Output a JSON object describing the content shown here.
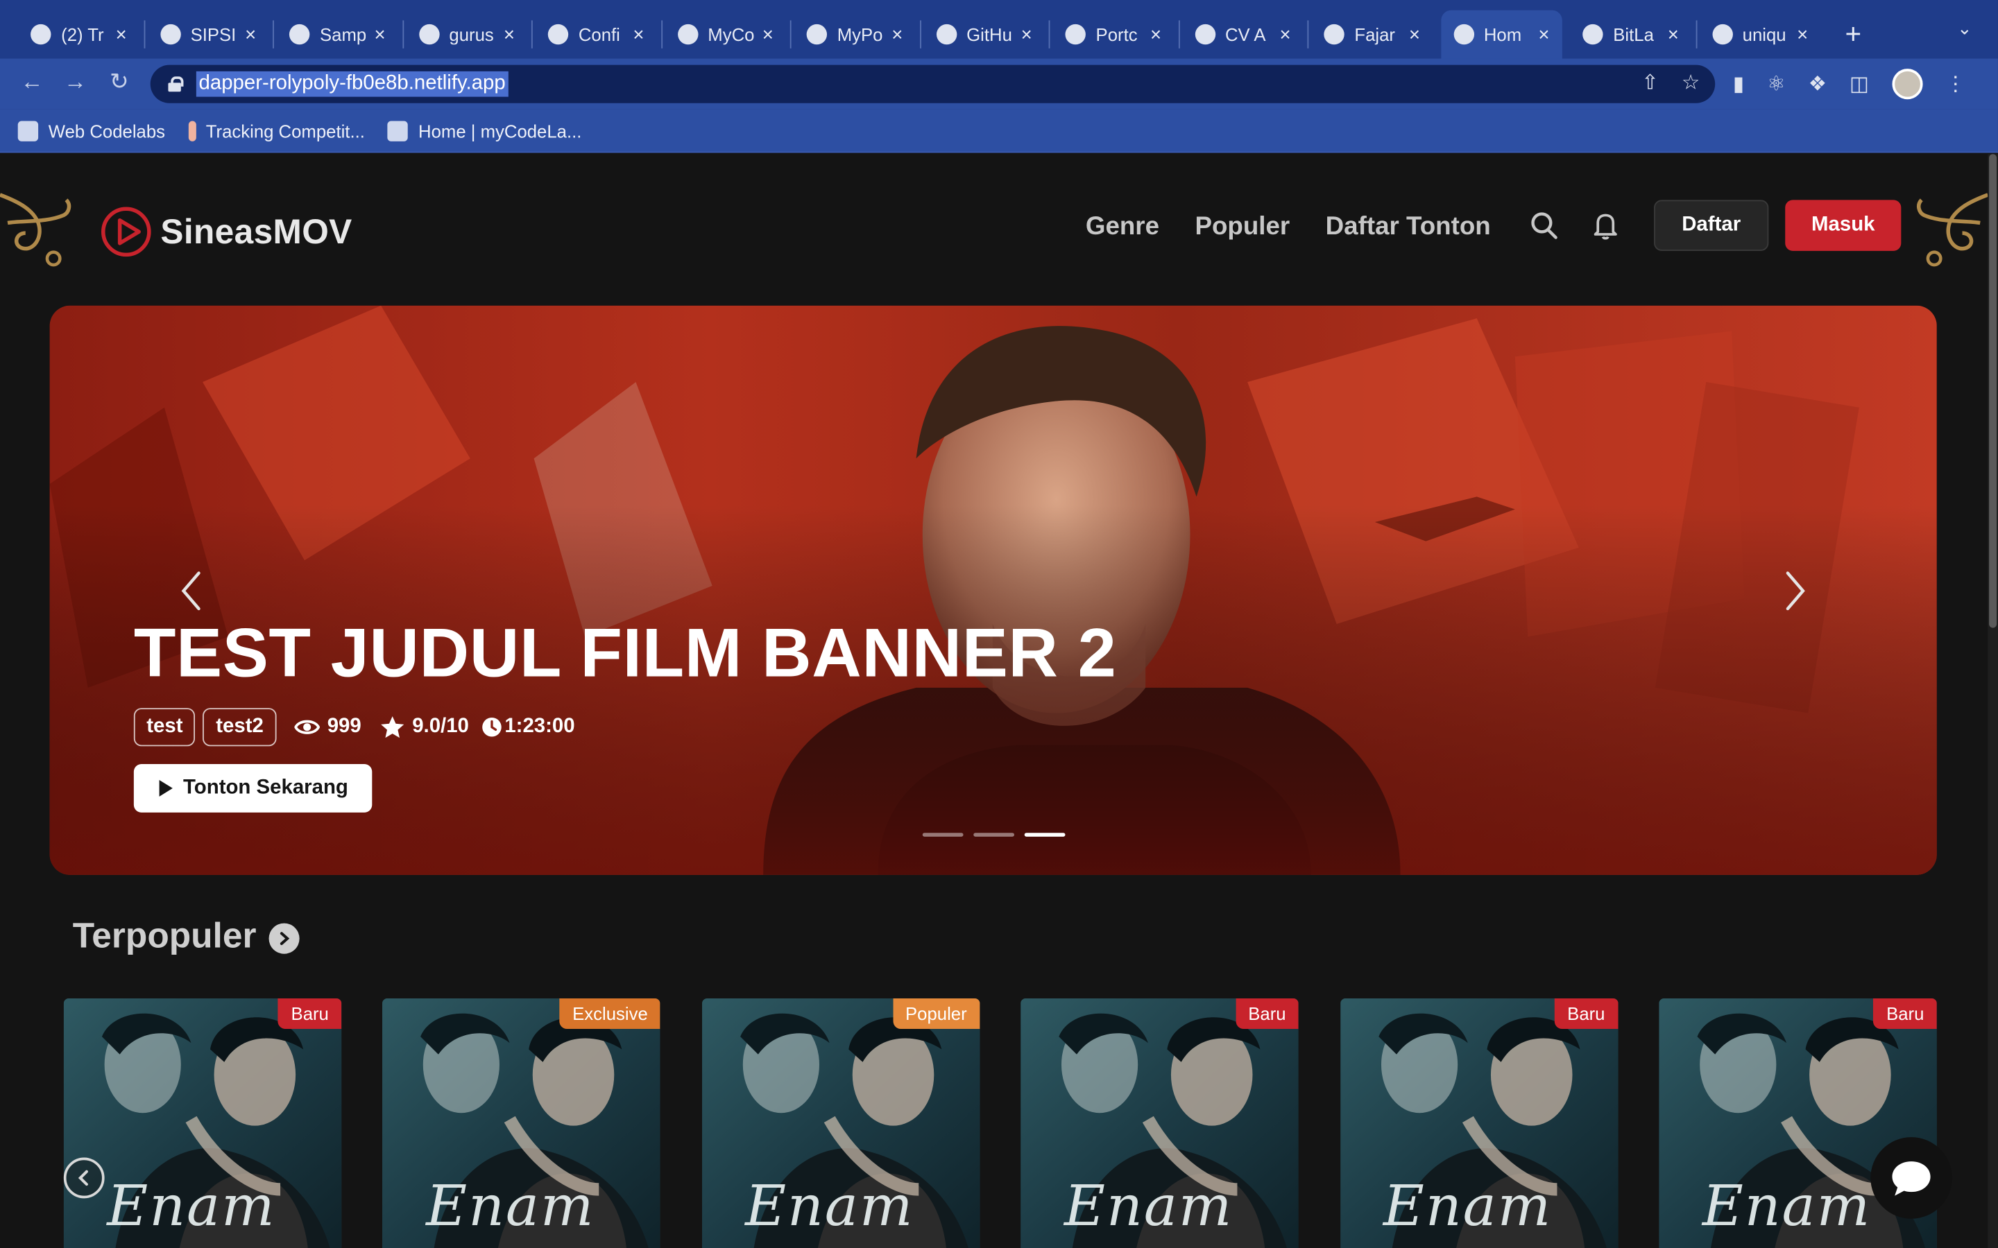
{
  "browser": {
    "tabs": [
      {
        "title": "(2) Tr",
        "icon": "notification-favicon-icon"
      },
      {
        "title": "SIPSI",
        "icon": "sipsi-favicon-icon"
      },
      {
        "title": "Samp",
        "icon": "sample-favicon-icon"
      },
      {
        "title": "gurus",
        "icon": "github-icon"
      },
      {
        "title": "Confi",
        "icon": "github-icon"
      },
      {
        "title": "MyCo",
        "icon": "firebase-icon"
      },
      {
        "title": "MyPo",
        "icon": "globe-icon"
      },
      {
        "title": "GitHu",
        "icon": "github-icon"
      },
      {
        "title": "Portc",
        "icon": "portfolio-favicon-icon"
      },
      {
        "title": "CV A",
        "icon": "docs-icon"
      },
      {
        "title": "Fajar",
        "icon": "github-icon"
      },
      {
        "title": "Hom",
        "icon": "nextjs-icon"
      },
      {
        "title": "BitLa",
        "icon": "globe-icon"
      },
      {
        "title": "uniqu",
        "icon": "diamond-favicon-icon"
      }
    ],
    "active_tab": 11,
    "url": "dapper-rolypoly-fb0e8b.netlify.app",
    "bookmarks": [
      "Web Codelabs",
      "Tracking Competit...",
      "Home | myCodeLa..."
    ]
  },
  "site": {
    "brand": "SineasMOV",
    "nav": [
      "Genre",
      "Populer",
      "Daftar Tonton"
    ],
    "register_label": "Daftar",
    "login_label": "Masuk"
  },
  "hero": {
    "title": "TEST JUDUL FILM BANNER 2",
    "tags": [
      "test",
      "test2"
    ],
    "views": "999",
    "rating": "9.0/10",
    "duration": "1:23:00",
    "watch_label": "Tonton Sekarang",
    "slides_total": 3,
    "active_slide": 3
  },
  "popular": {
    "title": "Terpopuler",
    "cards": [
      {
        "badge": "Baru",
        "badge_type": "baru",
        "poster_title": "Enam"
      },
      {
        "badge": "Exclusive",
        "badge_type": "exclusive",
        "poster_title": "Enam"
      },
      {
        "badge": "Populer",
        "badge_type": "populer",
        "poster_title": "Enam"
      },
      {
        "badge": "Baru",
        "badge_type": "baru",
        "poster_title": "Enam"
      },
      {
        "badge": "Baru",
        "badge_type": "baru",
        "poster_title": "Enam"
      },
      {
        "badge": "Baru",
        "badge_type": "baru",
        "poster_title": "Enam"
      }
    ]
  },
  "colors": {
    "accent": "#c8232c",
    "browser_chrome": "#1f3c8a",
    "page_bg": "#141414"
  }
}
